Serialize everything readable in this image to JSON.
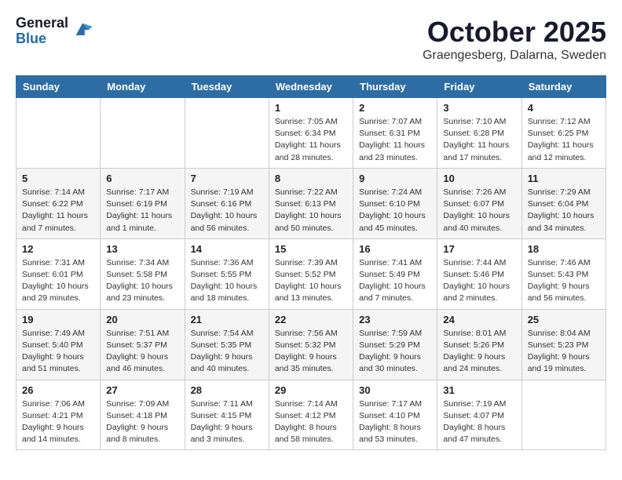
{
  "header": {
    "logo_general": "General",
    "logo_blue": "Blue",
    "title": "October 2025",
    "location": "Graengesberg, Dalarna, Sweden"
  },
  "weekdays": [
    "Sunday",
    "Monday",
    "Tuesday",
    "Wednesday",
    "Thursday",
    "Friday",
    "Saturday"
  ],
  "weeks": [
    [
      {
        "day": "",
        "info": ""
      },
      {
        "day": "",
        "info": ""
      },
      {
        "day": "",
        "info": ""
      },
      {
        "day": "1",
        "info": "Sunrise: 7:05 AM\nSunset: 6:34 PM\nDaylight: 11 hours\nand 28 minutes."
      },
      {
        "day": "2",
        "info": "Sunrise: 7:07 AM\nSunset: 6:31 PM\nDaylight: 11 hours\nand 23 minutes."
      },
      {
        "day": "3",
        "info": "Sunrise: 7:10 AM\nSunset: 6:28 PM\nDaylight: 11 hours\nand 17 minutes."
      },
      {
        "day": "4",
        "info": "Sunrise: 7:12 AM\nSunset: 6:25 PM\nDaylight: 11 hours\nand 12 minutes."
      }
    ],
    [
      {
        "day": "5",
        "info": "Sunrise: 7:14 AM\nSunset: 6:22 PM\nDaylight: 11 hours\nand 7 minutes."
      },
      {
        "day": "6",
        "info": "Sunrise: 7:17 AM\nSunset: 6:19 PM\nDaylight: 11 hours\nand 1 minute."
      },
      {
        "day": "7",
        "info": "Sunrise: 7:19 AM\nSunset: 6:16 PM\nDaylight: 10 hours\nand 56 minutes."
      },
      {
        "day": "8",
        "info": "Sunrise: 7:22 AM\nSunset: 6:13 PM\nDaylight: 10 hours\nand 50 minutes."
      },
      {
        "day": "9",
        "info": "Sunrise: 7:24 AM\nSunset: 6:10 PM\nDaylight: 10 hours\nand 45 minutes."
      },
      {
        "day": "10",
        "info": "Sunrise: 7:26 AM\nSunset: 6:07 PM\nDaylight: 10 hours\nand 40 minutes."
      },
      {
        "day": "11",
        "info": "Sunrise: 7:29 AM\nSunset: 6:04 PM\nDaylight: 10 hours\nand 34 minutes."
      }
    ],
    [
      {
        "day": "12",
        "info": "Sunrise: 7:31 AM\nSunset: 6:01 PM\nDaylight: 10 hours\nand 29 minutes."
      },
      {
        "day": "13",
        "info": "Sunrise: 7:34 AM\nSunset: 5:58 PM\nDaylight: 10 hours\nand 23 minutes."
      },
      {
        "day": "14",
        "info": "Sunrise: 7:36 AM\nSunset: 5:55 PM\nDaylight: 10 hours\nand 18 minutes."
      },
      {
        "day": "15",
        "info": "Sunrise: 7:39 AM\nSunset: 5:52 PM\nDaylight: 10 hours\nand 13 minutes."
      },
      {
        "day": "16",
        "info": "Sunrise: 7:41 AM\nSunset: 5:49 PM\nDaylight: 10 hours\nand 7 minutes."
      },
      {
        "day": "17",
        "info": "Sunrise: 7:44 AM\nSunset: 5:46 PM\nDaylight: 10 hours\nand 2 minutes."
      },
      {
        "day": "18",
        "info": "Sunrise: 7:46 AM\nSunset: 5:43 PM\nDaylight: 9 hours\nand 56 minutes."
      }
    ],
    [
      {
        "day": "19",
        "info": "Sunrise: 7:49 AM\nSunset: 5:40 PM\nDaylight: 9 hours\nand 51 minutes."
      },
      {
        "day": "20",
        "info": "Sunrise: 7:51 AM\nSunset: 5:37 PM\nDaylight: 9 hours\nand 46 minutes."
      },
      {
        "day": "21",
        "info": "Sunrise: 7:54 AM\nSunset: 5:35 PM\nDaylight: 9 hours\nand 40 minutes."
      },
      {
        "day": "22",
        "info": "Sunrise: 7:56 AM\nSunset: 5:32 PM\nDaylight: 9 hours\nand 35 minutes."
      },
      {
        "day": "23",
        "info": "Sunrise: 7:59 AM\nSunset: 5:29 PM\nDaylight: 9 hours\nand 30 minutes."
      },
      {
        "day": "24",
        "info": "Sunrise: 8:01 AM\nSunset: 5:26 PM\nDaylight: 9 hours\nand 24 minutes."
      },
      {
        "day": "25",
        "info": "Sunrise: 8:04 AM\nSunset: 5:23 PM\nDaylight: 9 hours\nand 19 minutes."
      }
    ],
    [
      {
        "day": "26",
        "info": "Sunrise: 7:06 AM\nSunset: 4:21 PM\nDaylight: 9 hours\nand 14 minutes."
      },
      {
        "day": "27",
        "info": "Sunrise: 7:09 AM\nSunset: 4:18 PM\nDaylight: 9 hours\nand 8 minutes."
      },
      {
        "day": "28",
        "info": "Sunrise: 7:11 AM\nSunset: 4:15 PM\nDaylight: 9 hours\nand 3 minutes."
      },
      {
        "day": "29",
        "info": "Sunrise: 7:14 AM\nSunset: 4:12 PM\nDaylight: 8 hours\nand 58 minutes."
      },
      {
        "day": "30",
        "info": "Sunrise: 7:17 AM\nSunset: 4:10 PM\nDaylight: 8 hours\nand 53 minutes."
      },
      {
        "day": "31",
        "info": "Sunrise: 7:19 AM\nSunset: 4:07 PM\nDaylight: 8 hours\nand 47 minutes."
      },
      {
        "day": "",
        "info": ""
      }
    ]
  ]
}
